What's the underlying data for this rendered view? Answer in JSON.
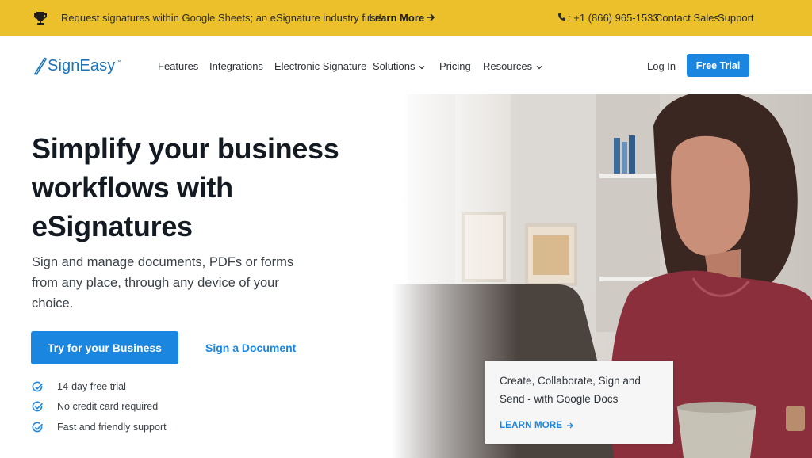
{
  "announcement": {
    "text": "Request signatures within Google Sheets; an eSignature industry first!",
    "link_label": "Learn More",
    "phone": ": +1 (866) 965-1533",
    "contact_label": "Contact Sales",
    "support_label": "Support",
    "background_color": "#ebc02a"
  },
  "brand": {
    "name": "SignEasy",
    "trademark": "™",
    "color": "#1a73b8"
  },
  "nav": {
    "items": [
      {
        "label": "Features",
        "has_dropdown": false
      },
      {
        "label": "Integrations",
        "has_dropdown": false
      },
      {
        "label": "Electronic Signature",
        "has_dropdown": false
      },
      {
        "label": "Solutions",
        "has_dropdown": true
      },
      {
        "label": "Pricing",
        "has_dropdown": false
      },
      {
        "label": "Resources",
        "has_dropdown": true
      }
    ],
    "login_label": "Log In",
    "cta_label": "Free Trial"
  },
  "hero": {
    "title": "Simplify your business workflows with eSignatures",
    "subtitle": "Sign and manage documents, PDFs or forms from any place, through any device of your choice.",
    "primary_cta": "Try for your Business",
    "secondary_cta": "Sign a Document",
    "features": [
      "14-day free trial",
      "No credit card required",
      "Fast and friendly support"
    ]
  },
  "promo_card": {
    "text": "Create, Collaborate, Sign and Send - with Google Docs",
    "link_label": "LEARN MORE"
  },
  "icons": {
    "trophy": "trophy-icon",
    "arrow": "arrow-right-icon",
    "phone": "phone-icon",
    "check": "check-circle-icon",
    "chevron": "chevron-down-icon"
  },
  "colors": {
    "accent": "#1b86e0",
    "heading": "#141a21"
  }
}
